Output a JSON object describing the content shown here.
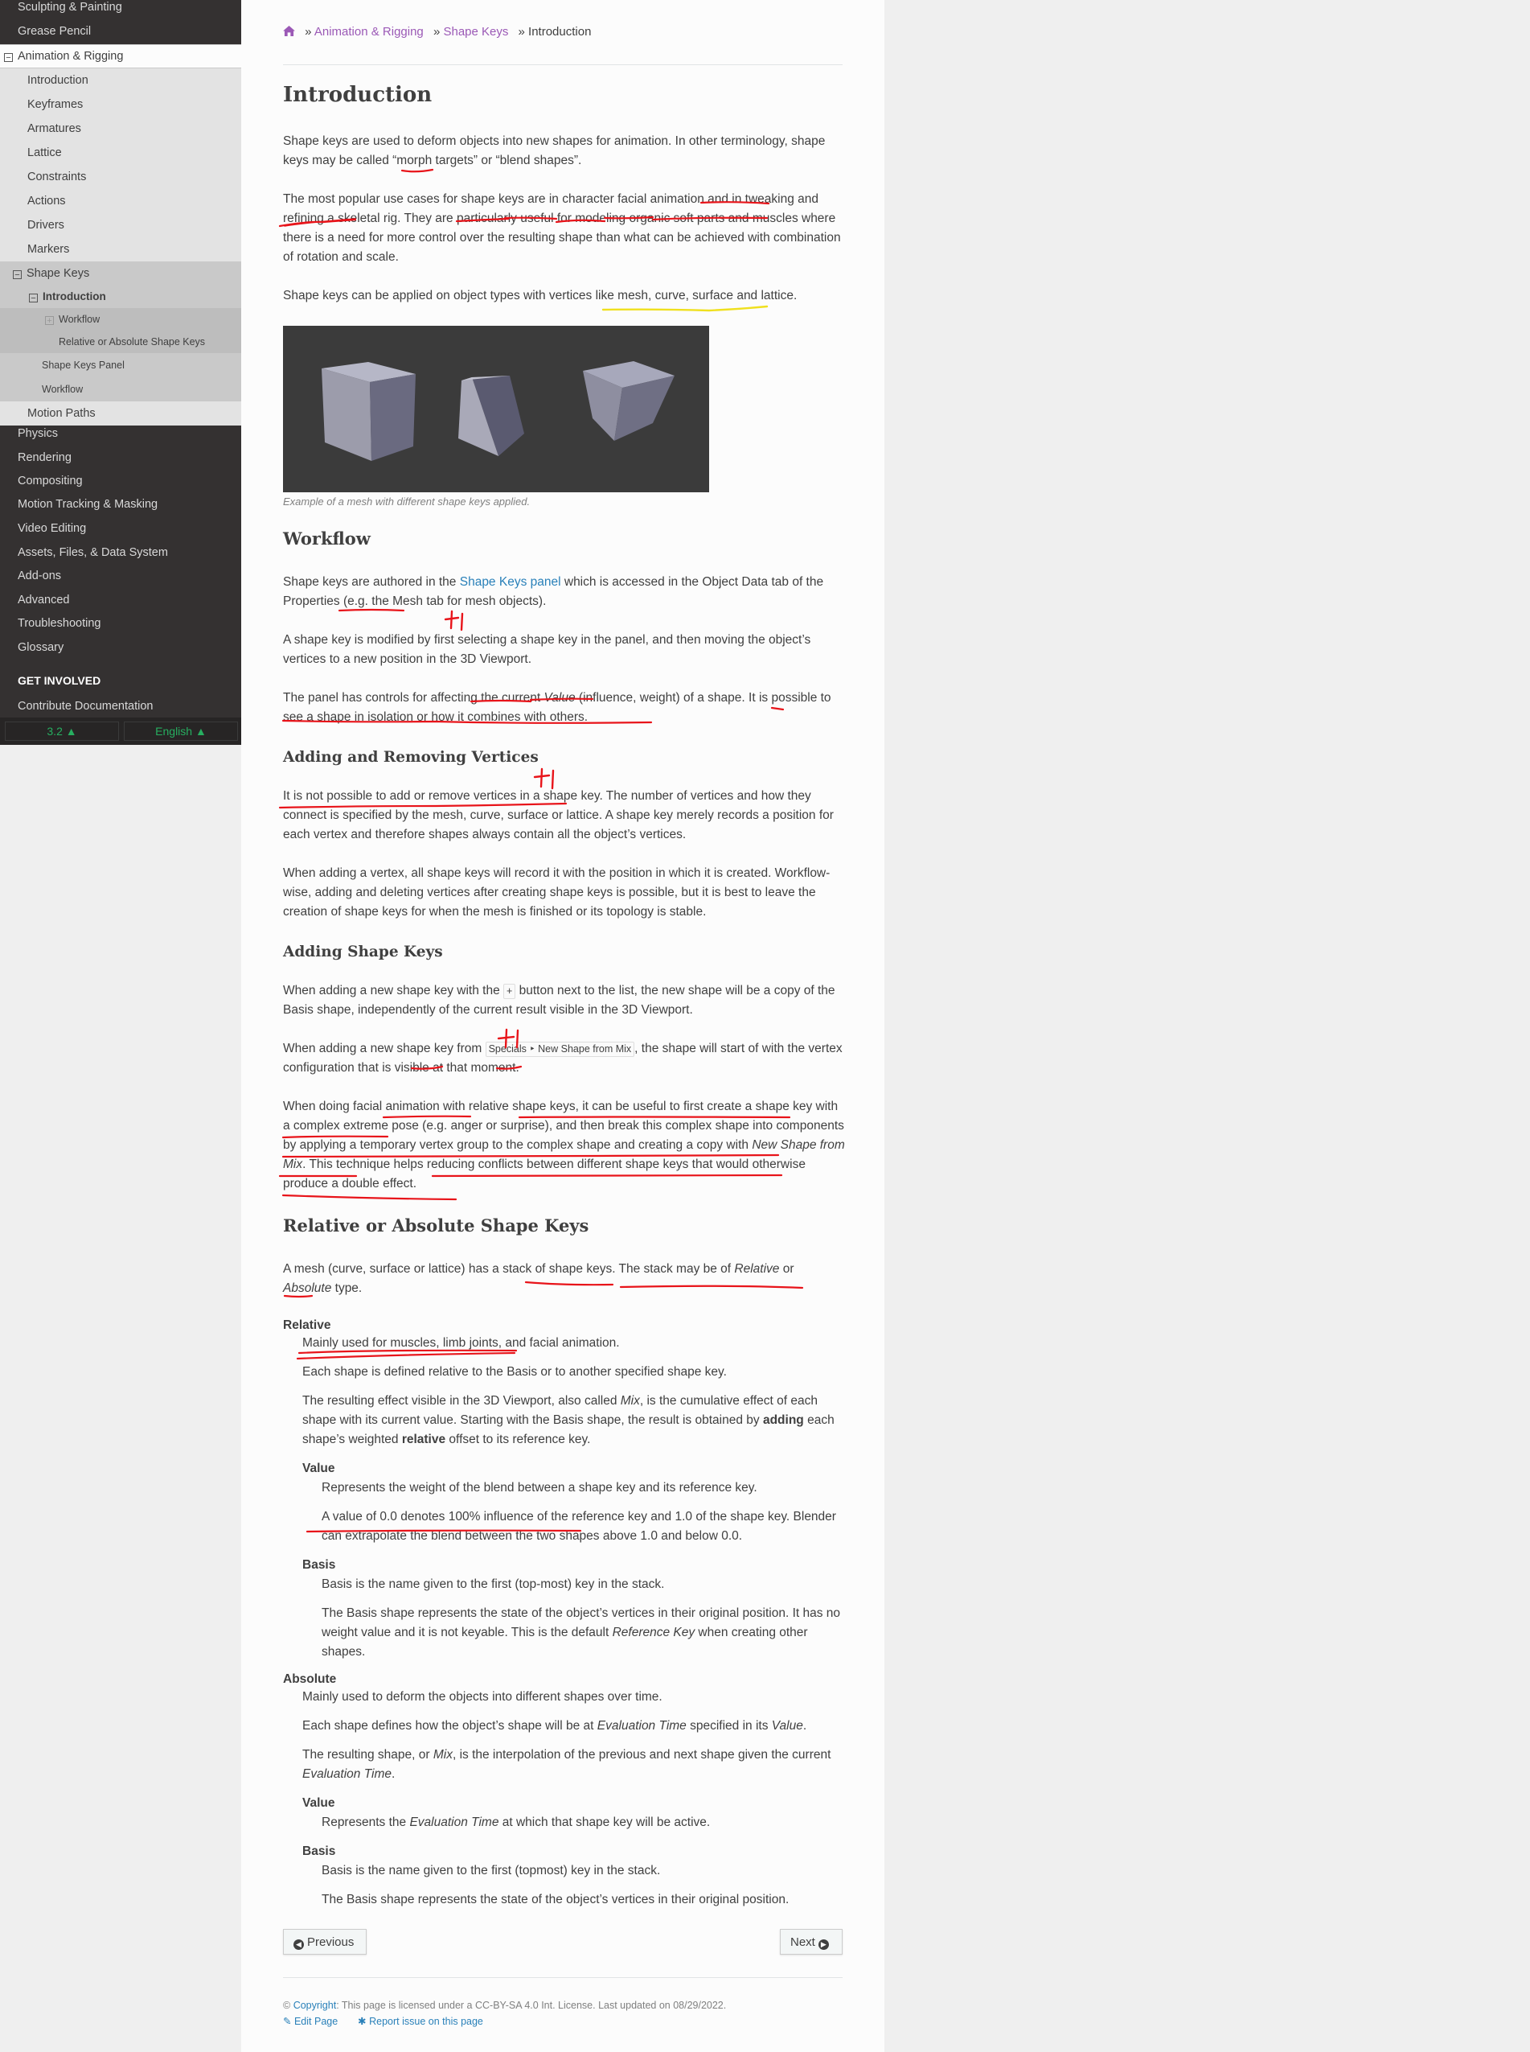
{
  "sidebar": {
    "top_items": [
      {
        "label": "Sculpting & Painting"
      },
      {
        "label": "Grease Pencil"
      }
    ],
    "current_section": {
      "toggle": "⊟",
      "label": "Animation & Rigging"
    },
    "section_items": [
      {
        "label": "Introduction"
      },
      {
        "label": "Keyframes"
      },
      {
        "label": "Armatures"
      },
      {
        "label": "Lattice"
      },
      {
        "label": "Constraints"
      },
      {
        "label": "Actions"
      },
      {
        "label": "Drivers"
      },
      {
        "label": "Markers"
      }
    ],
    "shape_keys": {
      "toggle": "⊟",
      "label": "Shape Keys",
      "introduction": {
        "toggle": "⊟",
        "label": "Introduction"
      },
      "workflow": {
        "toggle": "⊞",
        "label": "Workflow"
      },
      "relative": {
        "label": "Relative or Absolute Shape Keys"
      },
      "panel": {
        "label": "Shape Keys Panel"
      },
      "workflow2": {
        "label": "Workflow"
      }
    },
    "motion_paths": {
      "label": "Motion Paths"
    },
    "bottom_items": [
      {
        "label": "Physics"
      },
      {
        "label": "Rendering"
      },
      {
        "label": "Compositing"
      },
      {
        "label": "Motion Tracking & Masking"
      },
      {
        "label": "Video Editing"
      },
      {
        "label": "Assets, Files, & Data System"
      },
      {
        "label": "Add-ons"
      },
      {
        "label": "Advanced"
      },
      {
        "label": "Troubleshooting"
      },
      {
        "label": "Glossary"
      }
    ],
    "get_involved": "GET INVOLVED",
    "contribute": "Contribute Documentation",
    "version": "3.2 ▲",
    "language": "English ▲",
    "version_color": "#27ae60"
  },
  "breadcrumb": {
    "home_icon": "home-icon",
    "sep": "»",
    "items": [
      "Animation & Rigging",
      "Shape Keys",
      "Introduction"
    ]
  },
  "content": {
    "title": "Introduction",
    "intro_p1": "Shape keys are used to deform objects into new shapes for animation. In other terminology, shape keys may be called “morph targets” or “blend shapes”.",
    "intro_p2": "The most popular use cases for shape keys are in character facial animation and in tweaking and refining a skeletal rig. They are particularly useful for modeling organic soft parts and muscles where there is a need for more control over the resulting shape than what can be achieved with combination of rotation and scale.",
    "intro_p3": "Shape keys can be applied on object types with vertices like mesh, curve, surface and lattice.",
    "figure_caption": "Example of a mesh with different shape keys applied.",
    "workflow_title": "Workflow",
    "workflow_p1_a": "Shape keys are authored in the ",
    "workflow_p1_link": "Shape Keys panel",
    "workflow_p1_b": " which is accessed in the Object Data tab of the Properties (e.g. the Mesh tab for mesh objects).",
    "workflow_p2": "A shape key is modified by first selecting a shape key in the panel, and then moving the object’s vertices to a new position in the 3D Viewport.",
    "workflow_p3_a": "The panel has controls for affecting the current ",
    "workflow_p3_em": "Value",
    "workflow_p3_b": " (influence, weight) of a shape. It is possible to see a shape in isolation or how it combines with others.",
    "arv_title": "Adding and Removing Vertices",
    "arv_p1": "It is not possible to add or remove vertices in a shape key. The number of vertices and how they connect is specified by the mesh, curve, surface or lattice. A shape key merely records a position for each vertex and therefore shapes always contain all the object’s vertices.",
    "arv_p2": "When adding a vertex, all shape keys will record it with the position in which it is created. Workflow-wise, adding and deleting vertices after creating shape keys is possible, but it is best to leave the creation of shape keys for when the mesh is finished or its topology is stable.",
    "ask_title": "Adding Shape Keys",
    "ask_p1_a": "When adding a new shape key with the ",
    "ask_p1_kbd": "+",
    "ask_p1_b": " button next to the list, the new shape will be a copy of the Basis shape, independently of the current result visible in the 3D Viewport.",
    "ask_p2_a": "When adding a new shape key from ",
    "ask_p2_kbd": "Specials ‣ New Shape from Mix",
    "ask_p2_b": ", the shape will start of with the vertex configuration that is visible at that moment.",
    "ask_p3_a": "When doing facial animation with relative shape keys, it can be useful to first create a shape key with a complex extreme pose (e.g. anger or surprise), and then break this complex shape into components by applying a temporary vertex group to the complex shape and creating a copy with ",
    "ask_p3_em": "New Shape from Mix",
    "ask_p3_b": ". This technique helps reducing conflicts between different shape keys that would otherwise produce a double effect.",
    "roa_title": "Relative or Absolute Shape Keys",
    "roa_p1_a": "A mesh (curve, surface or lattice) has a stack of shape keys. The stack may be of ",
    "roa_p1_em1": "Relative",
    "roa_p1_or": " or ",
    "roa_p1_em2": "Absolute",
    "roa_p1_b": " type.",
    "rel_term": "Relative",
    "rel_d1": "Mainly used for muscles, limb joints, and facial animation.",
    "rel_d2": "Each shape is defined relative to the Basis or to another specified shape key.",
    "rel_d3_a": "The resulting effect visible in the 3D Viewport, also called ",
    "rel_d3_em": "Mix",
    "rel_d3_b": ", is the cumulative effect of each shape with its current value. Starting with the Basis shape, the result is obtained by ",
    "rel_d3_strong1": "adding",
    "rel_d3_c": " each shape’s weighted ",
    "rel_d3_strong2": "relative",
    "rel_d3_d": " offset to its reference key.",
    "rel_value_term": "Value",
    "rel_value_d1": "Represents the weight of the blend between a shape key and its reference key.",
    "rel_value_d2": "A value of 0.0 denotes 100% influence of the reference key and 1.0 of the shape key. Blender can extrapolate the blend between the two shapes above 1.0 and below 0.0.",
    "rel_basis_term": "Basis",
    "rel_basis_d1": "Basis is the name given to the first (top-most) key in the stack.",
    "rel_basis_d2_a": "The Basis shape represents the state of the object’s vertices in their original position. It has no weight value and it is not keyable. This is the default ",
    "rel_basis_d2_em": "Reference Key",
    "rel_basis_d2_b": " when creating other shapes.",
    "abs_term": "Absolute",
    "abs_d1": "Mainly used to deform the objects into different shapes over time.",
    "abs_d2_a": "Each shape defines how the object’s shape will be at ",
    "abs_d2_em1": "Evaluation Time",
    "abs_d2_b": " specified in its ",
    "abs_d2_em2": "Value",
    "abs_d2_c": ".",
    "abs_d3_a": "The resulting shape, or ",
    "abs_d3_em1": "Mix",
    "abs_d3_b": ", is the interpolation of the previous and next shape given the current ",
    "abs_d3_em2": "Evaluation Time",
    "abs_d3_c": ".",
    "abs_value_term": "Value",
    "abs_value_d1_a": "Represents the ",
    "abs_value_d1_em": "Evaluation Time",
    "abs_value_d1_b": " at which that shape key will be active.",
    "abs_basis_term": "Basis",
    "abs_basis_d1": "Basis is the name given to the first (topmost) key in the stack.",
    "abs_basis_d2": "The Basis shape represents the state of the object’s vertices in their original position."
  },
  "nav_buttons": {
    "previous": "Previous",
    "next": "Next"
  },
  "footer": {
    "copyright_link": "Copyright",
    "copyright_text": ": This page is licensed under a CC-BY-SA 4.0 Int. License. Last updated on 08/29/2022.",
    "edit_page": "Edit Page",
    "report_issue": "Report issue on this page"
  },
  "annotations": {
    "plus_one": "+1"
  }
}
